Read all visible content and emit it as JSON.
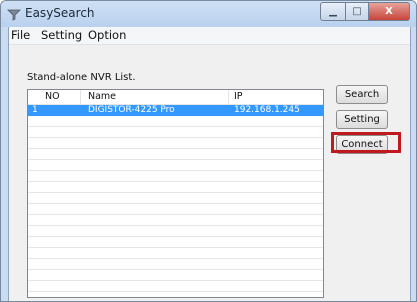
{
  "window": {
    "title": "EasySearch",
    "controls": {
      "minimize": "▁",
      "maximize": "□",
      "close": "X"
    }
  },
  "menu": {
    "items": [
      {
        "label": "File"
      },
      {
        "label": "Setting"
      },
      {
        "label": "Option"
      }
    ]
  },
  "list": {
    "label": "Stand-alone NVR List.",
    "columns": [
      "NO",
      "Name",
      "IP"
    ],
    "rows": [
      {
        "no": "1",
        "name": "DIGISTOR-4225 Pro",
        "ip": "192.168.1.245",
        "selected": true
      }
    ]
  },
  "buttons": {
    "search": "Search",
    "setting": "Setting",
    "connect": "Connect"
  },
  "colors": {
    "selection": "#3399ff",
    "highlight_box": "#c0191e"
  }
}
